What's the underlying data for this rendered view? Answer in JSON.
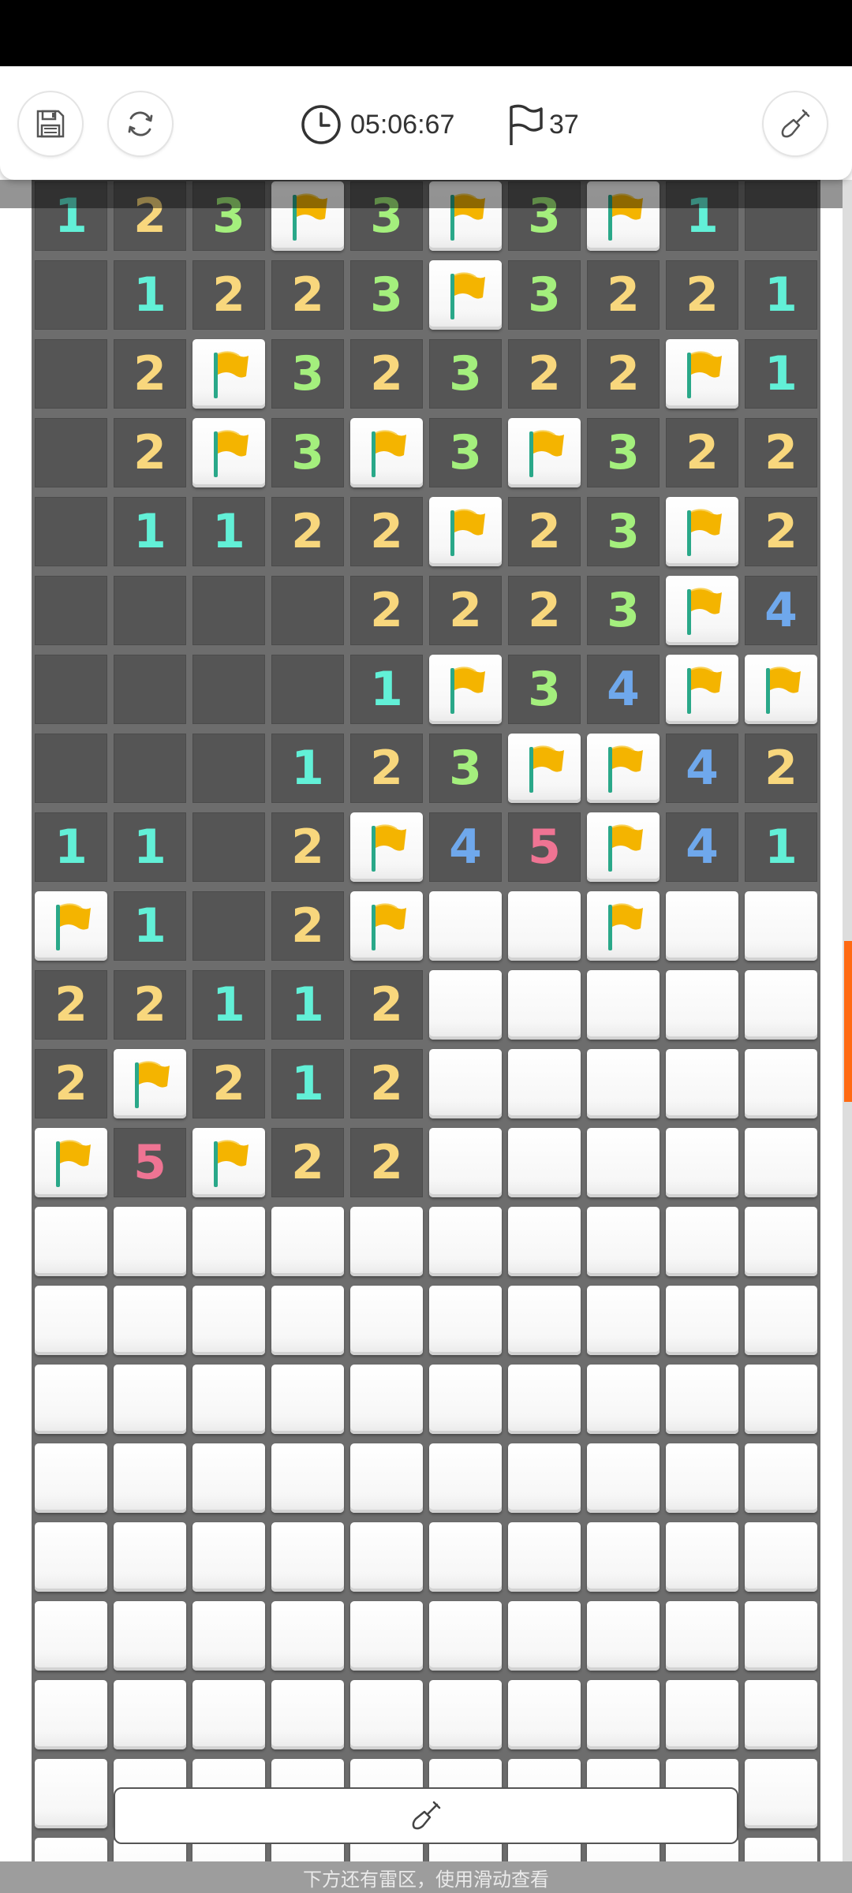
{
  "header": {
    "timer": "05:06:67",
    "flags_remaining": "37",
    "icons": {
      "save": "floppy-disk-icon",
      "restart": "refresh-icon",
      "timer": "clock-icon",
      "flags": "flag-outline-icon",
      "mode": "shovel-icon"
    }
  },
  "board": {
    "columns": 10,
    "visible_rows": 22,
    "legend": "number = revealed count, F = flag, . = revealed empty, # = unrevealed",
    "rows": [
      "123F3F3F1.",
      ".1223F3221",
      ".2F32322F1",
      ".2F3F3F322",
      ".1122F23F2",
      "....2223F4",
      "....1F34FF",
      "...123FF42",
      "11.2F45F41",
      "F1.2F##F##",
      "22112#####",
      "2F212#####",
      "F5F22#####",
      "##########",
      "##########",
      "##########",
      "##########",
      "##########",
      "##########",
      "##########",
      "##########",
      "##########"
    ]
  },
  "number_colors": {
    "1": "#62f0d7",
    "2": "#f8d77d",
    "3": "#a4ef7d",
    "4": "#6fa8ec",
    "5": "#ef7493"
  },
  "colors": {
    "flag": "#f4b400",
    "flag_pole": "#2aa889",
    "opened_cell": "#555555",
    "grid": "#6d6d6d",
    "scroll_thumb": "#ff6a13"
  },
  "footer": {
    "dig_icon": "shovel-icon",
    "hint": "下方还有雷区，使用滑动查看"
  }
}
